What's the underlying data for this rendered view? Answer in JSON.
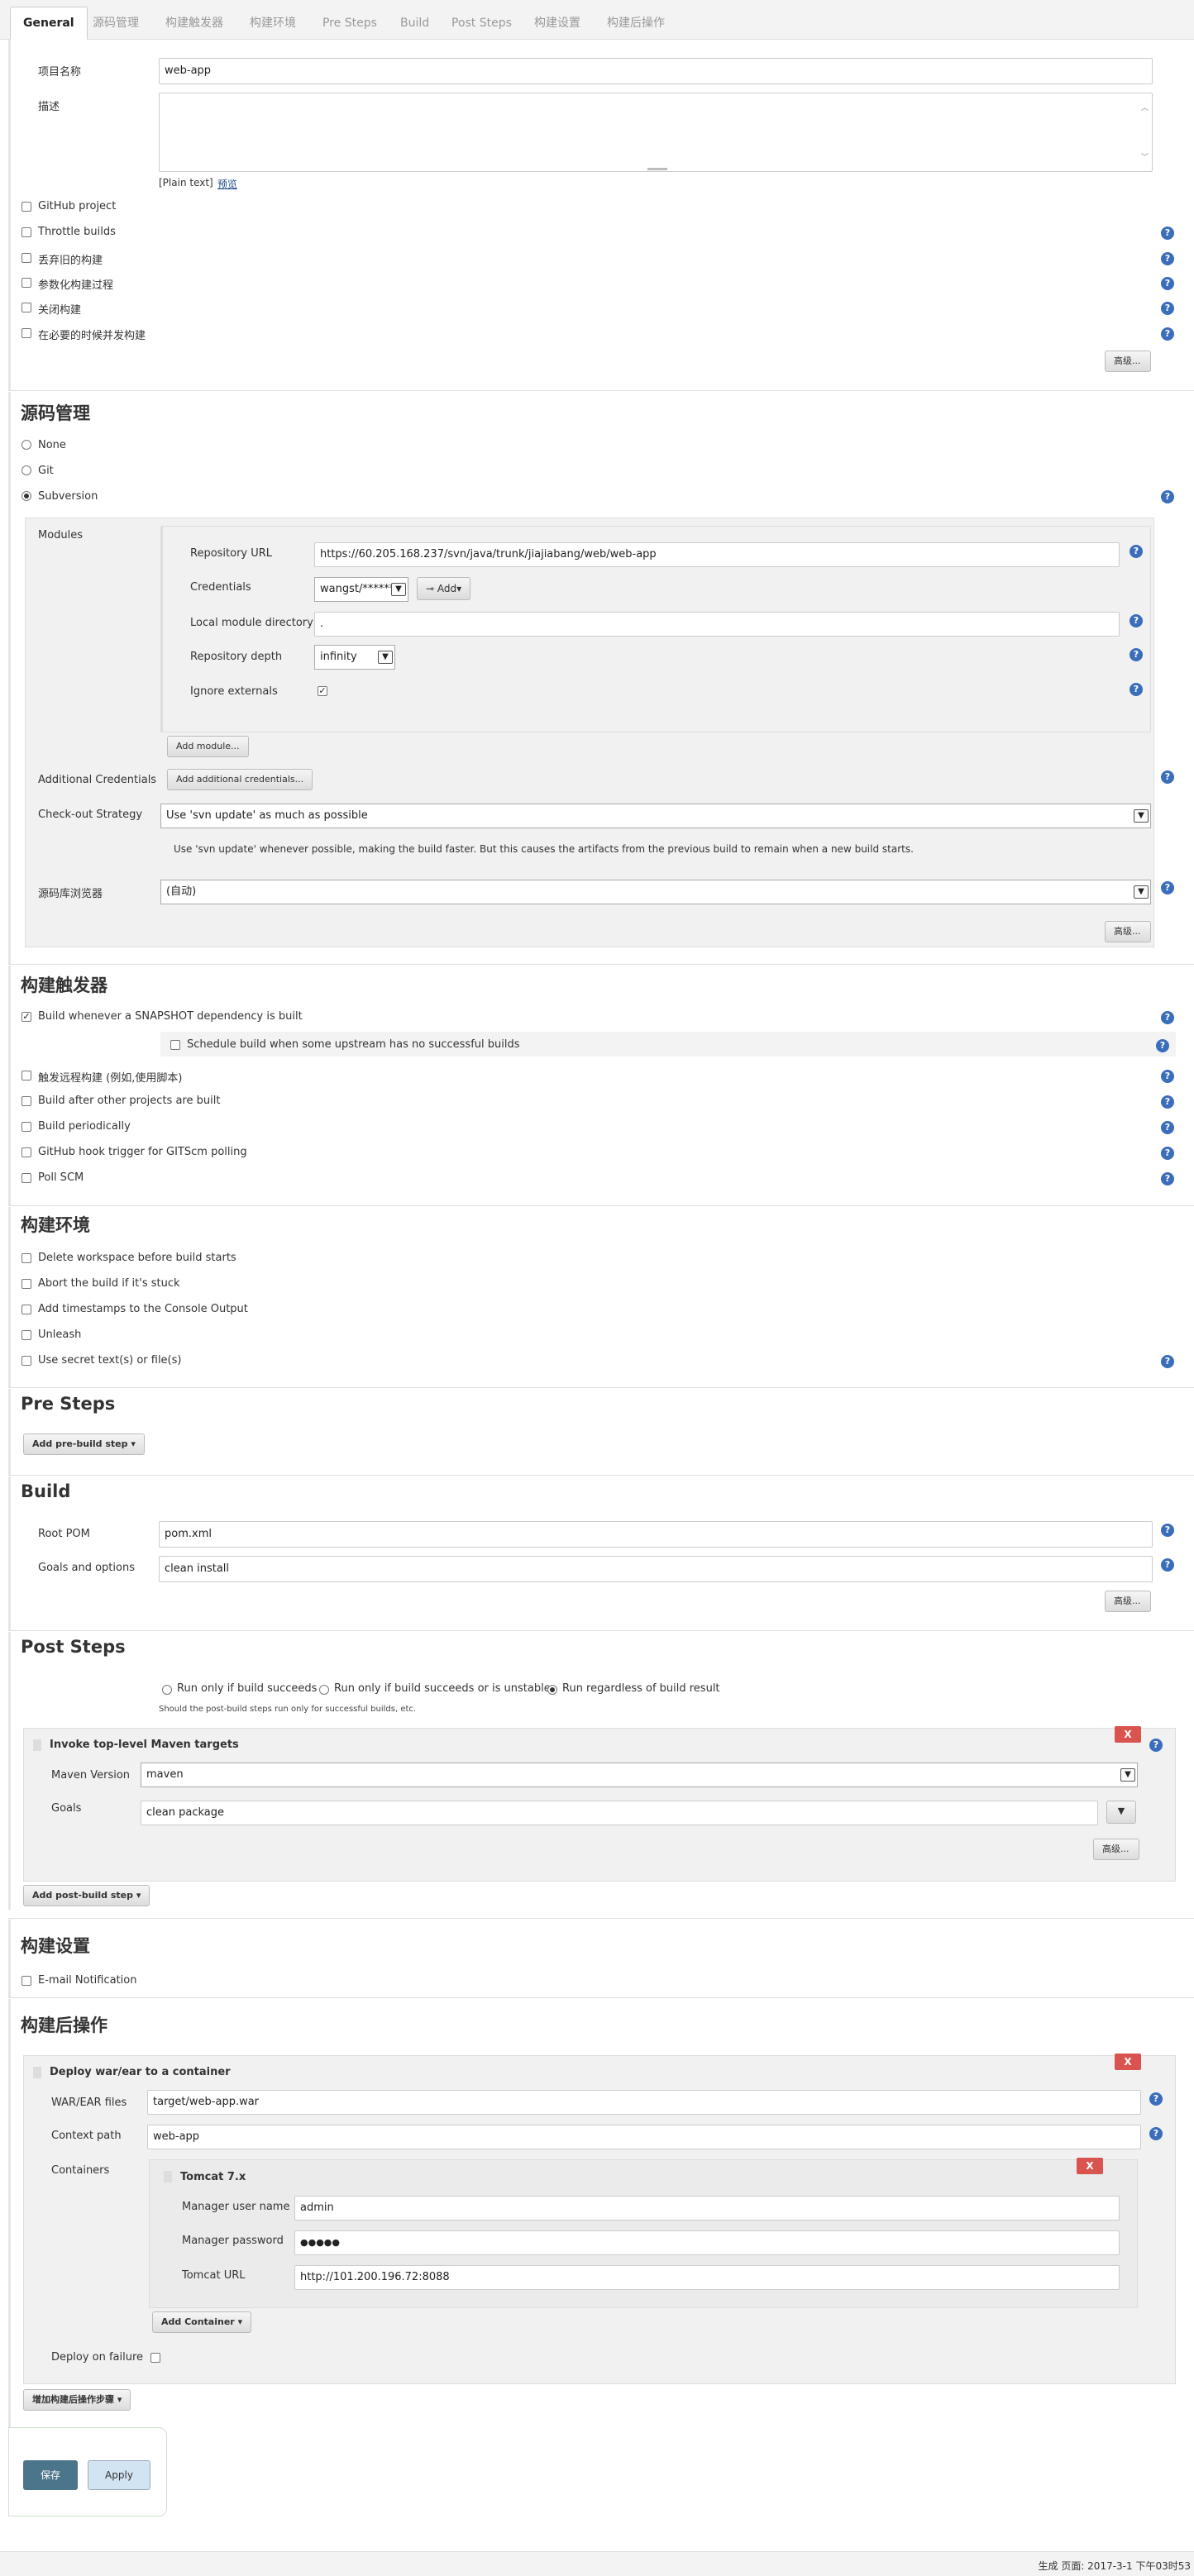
{
  "tabs": [
    "General",
    "源码管理",
    "构建触发器",
    "构建环境",
    "Pre Steps",
    "Build",
    "Post Steps",
    "构建设置",
    "构建后操作"
  ],
  "general": {
    "project_name_label": "项目名称",
    "project_name_value": "web-app",
    "description_label": "描述",
    "plain_text": "[Plain text]",
    "preview_link": "预览",
    "options": [
      "GitHub project",
      "Throttle builds",
      "丢弃旧的构建",
      "参数化构建过程",
      "关闭构建",
      "在必要的时候并发构建"
    ],
    "advanced_btn": "高级..."
  },
  "scm": {
    "title": "源码管理",
    "options": [
      "None",
      "Git",
      "Subversion"
    ],
    "modules_label": "Modules",
    "repo_url_label": "Repository URL",
    "repo_url_value": "https://60.205.168.237/svn/java/trunk/jiajiabang/web/web-app",
    "credentials_label": "Credentials",
    "credentials_value": "wangst/******",
    "add_btn": "Add",
    "local_dir_label": "Local module directory",
    "local_dir_value": ".",
    "depth_label": "Repository depth",
    "depth_value": "infinity",
    "ignore_ext_label": "Ignore externals",
    "add_module_btn": "Add module...",
    "additional_creds_label": "Additional Credentials",
    "additional_creds_btn": "Add additional credentials...",
    "checkout_label": "Check-out Strategy",
    "checkout_value": "Use 'svn update' as much as possible",
    "checkout_desc": "Use 'svn update' whenever possible, making the build faster. But this causes the artifacts from the previous build to remain when a new build starts.",
    "browser_label": "源码库浏览器",
    "browser_value": "(自动)",
    "advanced_btn": "高级..."
  },
  "triggers": {
    "title": "构建触发器",
    "snapshot": "Build whenever a SNAPSHOT dependency is built",
    "schedule_upstream": "Schedule build when some upstream has no successful builds",
    "options": [
      "触发远程构建 (例如,使用脚本)",
      "Build after other projects are built",
      "Build periodically",
      "GitHub hook trigger for GITScm polling",
      "Poll SCM"
    ]
  },
  "env": {
    "title": "构建环境",
    "options": [
      "Delete workspace before build starts",
      "Abort the build if it's stuck",
      "Add timestamps to the Console Output",
      "Unleash",
      "Use secret text(s) or file(s)"
    ]
  },
  "pre_steps": {
    "title": "Pre Steps",
    "add_btn": "Add pre-build step"
  },
  "build": {
    "title": "Build",
    "root_pom_label": "Root POM",
    "root_pom_value": "pom.xml",
    "goals_label": "Goals and options",
    "goals_value": "clean install",
    "advanced_btn": "高级..."
  },
  "post_steps": {
    "title": "Post Steps",
    "radio_options": [
      "Run only if build succeeds",
      "Run only if build succeeds or is unstable",
      "Run regardless of build result"
    ],
    "radio_note": "Should the post-build steps run only for successful builds, etc.",
    "maven_title": "Invoke top-level Maven targets",
    "maven_version_label": "Maven Version",
    "maven_version_value": "maven",
    "goals_label": "Goals",
    "goals_value": "clean package",
    "advanced_btn": "高级...",
    "add_btn": "Add post-build step",
    "delete_btn": "X"
  },
  "build_settings": {
    "title": "构建设置",
    "email": "E-mail Notification"
  },
  "post_build": {
    "title": "构建后操作",
    "deploy_title": "Deploy war/ear to a container",
    "war_label": "WAR/EAR files",
    "war_value": "target/web-app.war",
    "context_label": "Context path",
    "context_value": "web-app",
    "containers_label": "Containers",
    "tomcat_title": "Tomcat 7.x",
    "manager_user_label": "Manager user name",
    "manager_user_value": "admin",
    "manager_pass_label": "Manager password",
    "manager_pass_value": "●●●●●",
    "tomcat_url_label": "Tomcat URL",
    "tomcat_url_value": "http://101.200.196.72:8088",
    "add_container_btn": "Add Container",
    "deploy_failure_label": "Deploy on failure",
    "add_btn": "增加构建后操作步骤",
    "delete_btn": "X"
  },
  "actions": {
    "save": "保存",
    "apply": "Apply"
  },
  "footer": {
    "text": "生成 页面: 2017-3-1 下午03时53"
  }
}
